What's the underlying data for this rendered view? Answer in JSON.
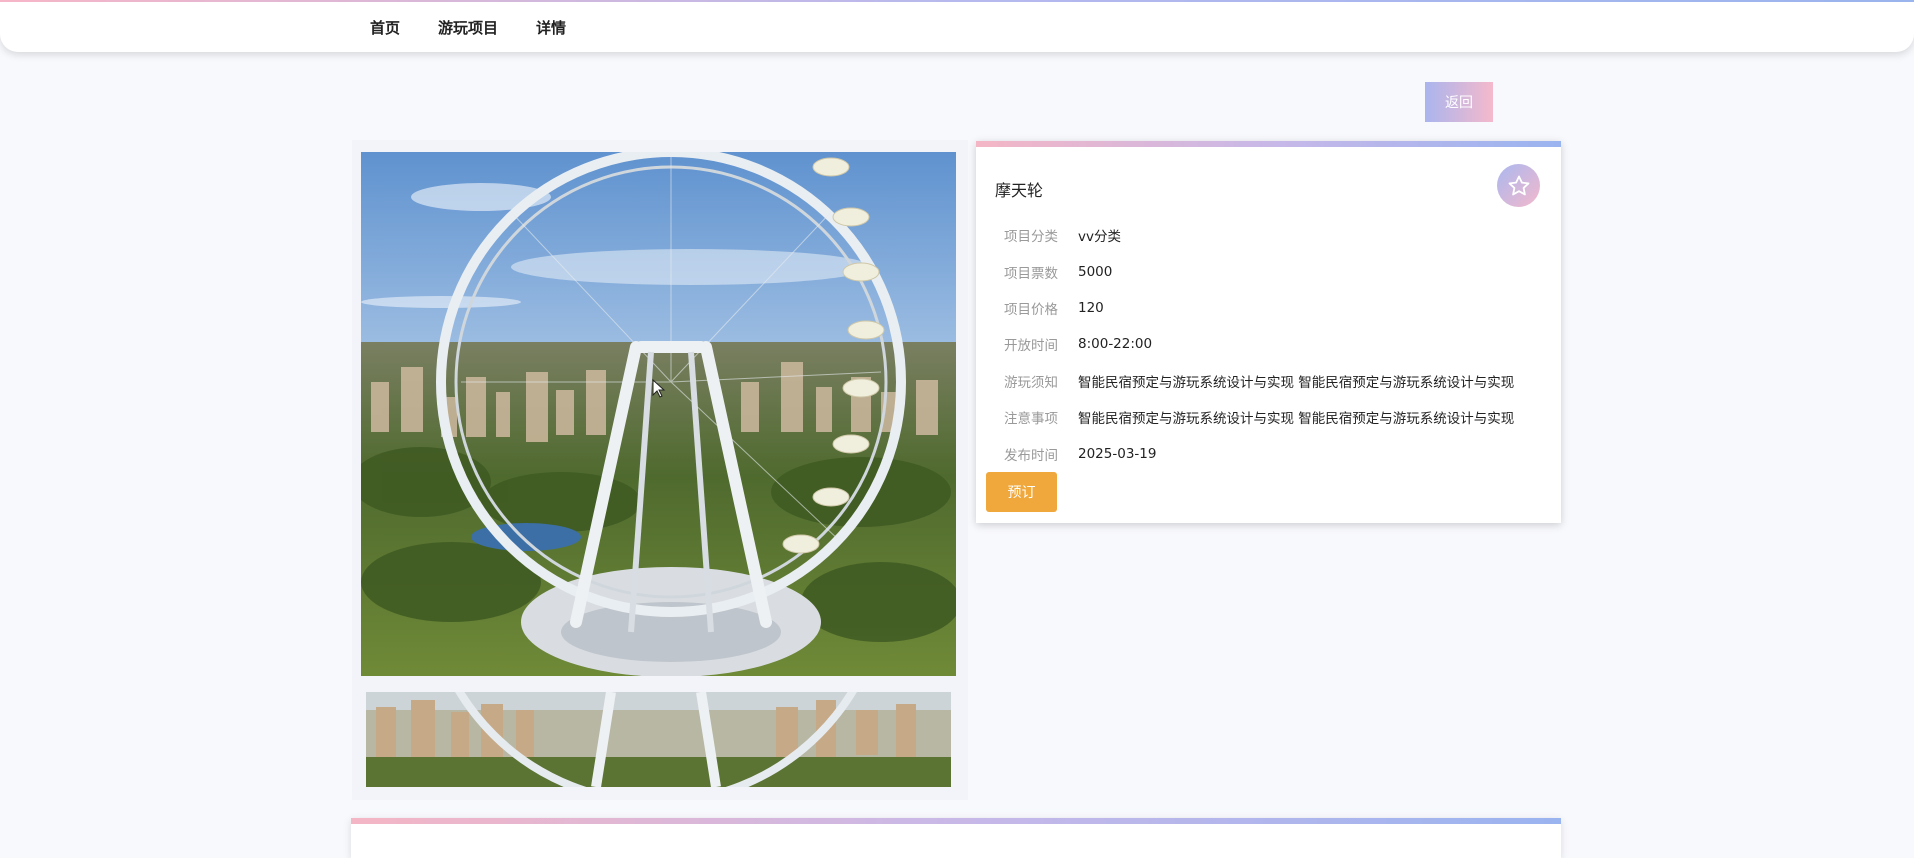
{
  "nav": {
    "items": [
      {
        "label": "首页"
      },
      {
        "label": "游玩项目"
      },
      {
        "label": "详情"
      }
    ]
  },
  "back_button": {
    "label": "返回"
  },
  "detail": {
    "title": "摩天轮",
    "rows": [
      {
        "label": "项目分类",
        "value": "vv分类"
      },
      {
        "label": "项目票数",
        "value": "5000"
      },
      {
        "label": "项目价格",
        "value": "120"
      },
      {
        "label": "开放时间",
        "value": "8:00-22:00"
      },
      {
        "label": "游玩须知",
        "value": "智能民宿预定与游玩系统设计与实现 智能民宿预定与游玩系统设计与实现"
      },
      {
        "label": "注意事项",
        "value": "智能民宿预定与游玩系统设计与实现 智能民宿预定与游玩系统设计与实现"
      },
      {
        "label": "发布时间",
        "value": "2025-03-19"
      }
    ],
    "book_label": "预订",
    "favorite_icon": "star-icon"
  },
  "colors": {
    "accent_pink": "#f5b9cb",
    "accent_blue": "#9ab4ee",
    "book_orange": "#f0a83c"
  }
}
